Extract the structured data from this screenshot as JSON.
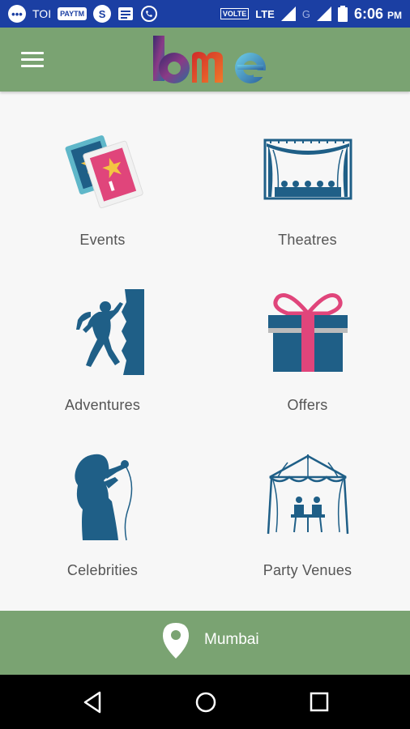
{
  "status_bar": {
    "left_labels": {
      "toi": "TOI",
      "paytm": "PAYTM",
      "skype": "S"
    },
    "volte": "VOLTE",
    "lte": "LTE",
    "g": "G",
    "time": "6:06",
    "ampm": "PM"
  },
  "app": {
    "logo_text": "bme",
    "brand_color": "#7aa372",
    "icon_color": "#1f5f87",
    "accent_pink": "#e0457b"
  },
  "categories": [
    {
      "label": "Events",
      "icon": "tickets-icon"
    },
    {
      "label": "Theatres",
      "icon": "theatre-stage-icon"
    },
    {
      "label": "Adventures",
      "icon": "rock-climber-icon"
    },
    {
      "label": "Offers",
      "icon": "gift-box-icon"
    },
    {
      "label": "Celebrities",
      "icon": "singer-icon"
    },
    {
      "label": "Party Venues",
      "icon": "party-tent-icon"
    }
  ],
  "location": {
    "city": "Mumbai",
    "icon": "location-pin-icon"
  },
  "nav": {
    "back": "back-icon",
    "home": "home-icon",
    "recents": "recents-icon"
  }
}
